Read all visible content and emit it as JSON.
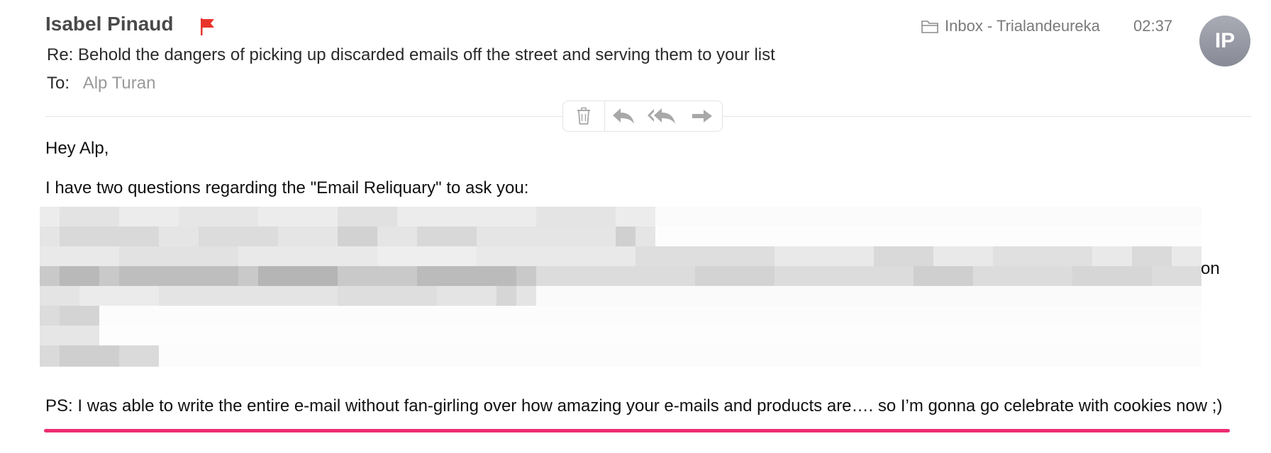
{
  "message": {
    "sender": "Isabel Pinaud",
    "subject": "Re: Behold the dangers of picking up discarded emails off the street and serving them to your list",
    "to_label": "To:",
    "to_value": "Alp Turan",
    "mailbox": "Inbox - Trialandeureka",
    "time": "02:37",
    "avatar_initials": "IP",
    "flag_color": "#e8332a"
  },
  "toolbar": {
    "icons": [
      "trash-icon",
      "reply-icon",
      "reply-all-icon",
      "forward-icon"
    ]
  },
  "body": {
    "greeting": "Hey Alp,",
    "intro": "I have two questions regarding the \"Email Reliquary\" to ask you:",
    "visible_fragment": "on",
    "ps": "PS: I was able to write the entire e-mail without fan-girling over how amazing your e-mails and products are…. so I’m gonna go celebrate with cookies now ;)",
    "ps_underline_color": "#ee2d73"
  }
}
